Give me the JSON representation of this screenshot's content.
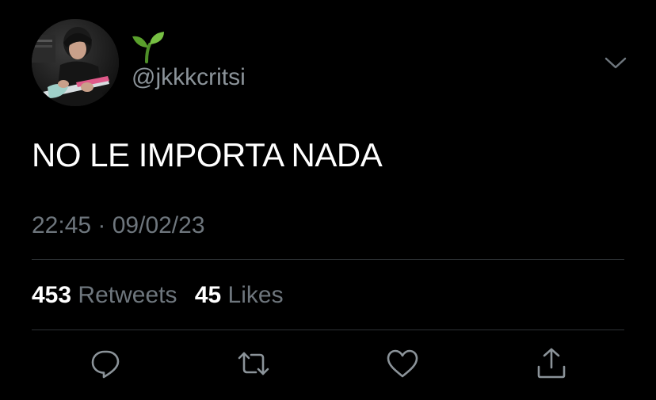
{
  "tweet": {
    "display_name_emoji": "seedling",
    "handle": "@jkkkcritsi",
    "text": "NO LE IMPORTA NADA",
    "timestamp": "22:45 · 09/02/23",
    "stats": {
      "retweets_count": "453",
      "retweets_label": "Retweets",
      "likes_count": "45",
      "likes_label": "Likes"
    }
  },
  "icons": {
    "more": "chevron-down-icon",
    "reply": "reply-icon",
    "retweet": "retweet-icon",
    "like": "heart-icon",
    "share": "share-icon"
  },
  "colors": {
    "background": "#000000",
    "primary_text": "#ffffff",
    "secondary_text": "#6e767d",
    "divider": "#2f3336",
    "seedling": "#5aa02c"
  }
}
